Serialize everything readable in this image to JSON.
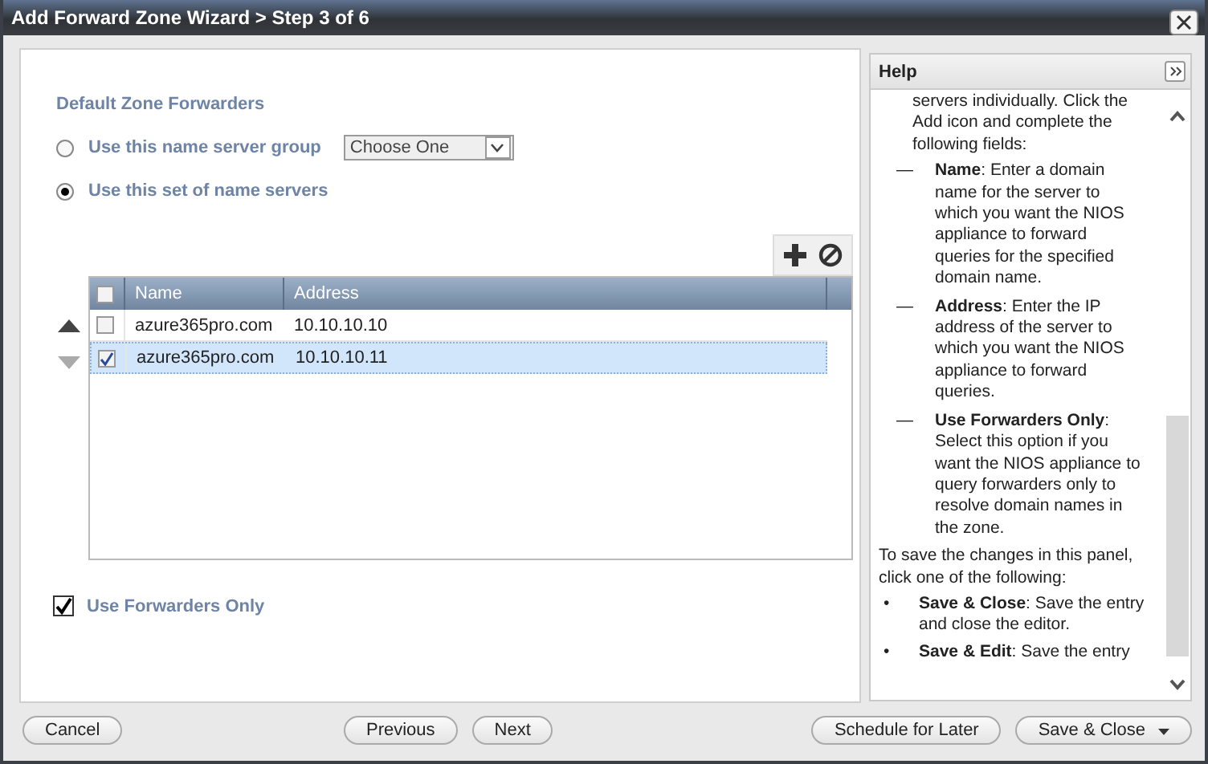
{
  "window": {
    "title": "Add Forward Zone Wizard > Step 3 of 6"
  },
  "section_title": "Default Zone Forwarders",
  "options": [
    {
      "label": "Use this name server group",
      "selected": false,
      "select": {
        "value": "Choose One"
      }
    },
    {
      "label": "Use this set of name servers",
      "selected": true
    }
  ],
  "move_up": {
    "disabled": false
  },
  "move_down": {
    "disabled": true
  },
  "table": {
    "select_all": false,
    "columns": [
      "Name",
      "Address"
    ],
    "rows": [
      {
        "name": "azure365pro.com",
        "address": "10.10.10.10",
        "checked": false,
        "selected": false
      },
      {
        "name": "azure365pro.com",
        "address": "10.10.10.11",
        "checked": true,
        "selected": true
      }
    ]
  },
  "use_forwarders_only": {
    "label": "Use Forwarders Only",
    "checked": true
  },
  "help": {
    "title": "Help",
    "paragraphs": [
      {
        "kind": "text",
        "text": "servers individually. Click the Add icon and complete the following fields:"
      },
      {
        "kind": "dash",
        "marker": "—",
        "text": "**Name**: Enter a domain name for the server to which you want the NIOS appliance to forward queries for the specified domain name."
      },
      {
        "kind": "dash",
        "marker": "—",
        "text": "**Address**: Enter the IP address of the server to which you want the NIOS appliance to forward queries."
      },
      {
        "kind": "dash",
        "marker": "—",
        "text": "**Use Forwarders Only**: Select this option if you want the NIOS appliance to query forwarders only to resolve domain names in the zone."
      },
      {
        "kind": "para",
        "text": "To save the changes in this panel, click one of the following:"
      },
      {
        "kind": "bullet",
        "marker": "•",
        "text": "**Save & Close**: Save the entry and close the editor."
      },
      {
        "kind": "bullet",
        "marker": "•",
        "text": "**Save & Edit**: Save the entry"
      }
    ]
  },
  "footer": {
    "left": [
      {
        "label": "Cancel",
        "has_menu": false
      }
    ],
    "center": [
      {
        "label": "Previous",
        "has_menu": false
      },
      {
        "label": "Next",
        "has_menu": false
      }
    ],
    "right": [
      {
        "label": "Schedule for Later",
        "has_menu": false
      },
      {
        "label": "Save & Close",
        "has_menu": true
      }
    ]
  }
}
